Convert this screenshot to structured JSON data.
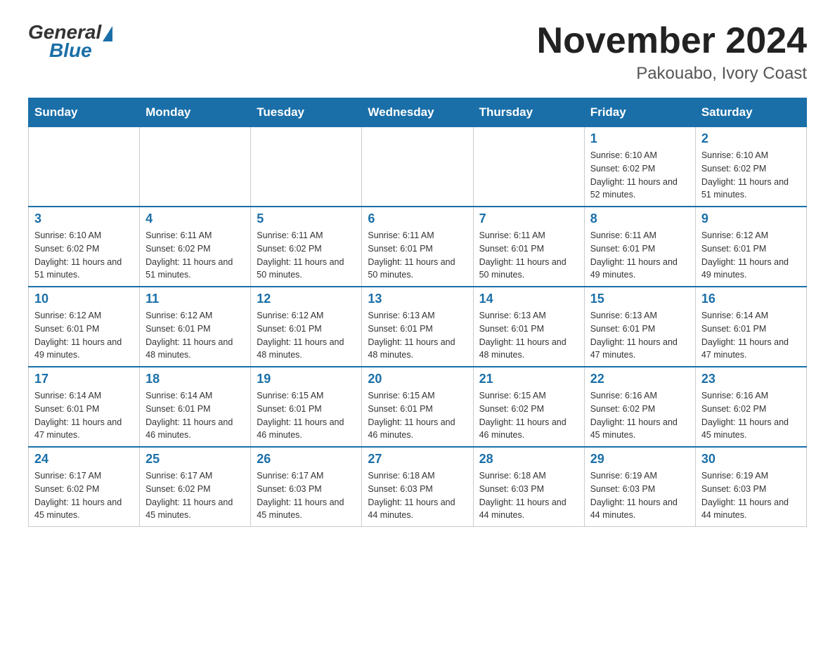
{
  "header": {
    "logo": {
      "general_text": "General",
      "blue_text": "Blue"
    },
    "title": "November 2024",
    "location": "Pakouabo, Ivory Coast"
  },
  "weekdays": [
    "Sunday",
    "Monday",
    "Tuesday",
    "Wednesday",
    "Thursday",
    "Friday",
    "Saturday"
  ],
  "weeks": [
    [
      {
        "day": "",
        "sunrise": "",
        "sunset": "",
        "daylight": ""
      },
      {
        "day": "",
        "sunrise": "",
        "sunset": "",
        "daylight": ""
      },
      {
        "day": "",
        "sunrise": "",
        "sunset": "",
        "daylight": ""
      },
      {
        "day": "",
        "sunrise": "",
        "sunset": "",
        "daylight": ""
      },
      {
        "day": "",
        "sunrise": "",
        "sunset": "",
        "daylight": ""
      },
      {
        "day": "1",
        "sunrise": "Sunrise: 6:10 AM",
        "sunset": "Sunset: 6:02 PM",
        "daylight": "Daylight: 11 hours and 52 minutes."
      },
      {
        "day": "2",
        "sunrise": "Sunrise: 6:10 AM",
        "sunset": "Sunset: 6:02 PM",
        "daylight": "Daylight: 11 hours and 51 minutes."
      }
    ],
    [
      {
        "day": "3",
        "sunrise": "Sunrise: 6:10 AM",
        "sunset": "Sunset: 6:02 PM",
        "daylight": "Daylight: 11 hours and 51 minutes."
      },
      {
        "day": "4",
        "sunrise": "Sunrise: 6:11 AM",
        "sunset": "Sunset: 6:02 PM",
        "daylight": "Daylight: 11 hours and 51 minutes."
      },
      {
        "day": "5",
        "sunrise": "Sunrise: 6:11 AM",
        "sunset": "Sunset: 6:02 PM",
        "daylight": "Daylight: 11 hours and 50 minutes."
      },
      {
        "day": "6",
        "sunrise": "Sunrise: 6:11 AM",
        "sunset": "Sunset: 6:01 PM",
        "daylight": "Daylight: 11 hours and 50 minutes."
      },
      {
        "day": "7",
        "sunrise": "Sunrise: 6:11 AM",
        "sunset": "Sunset: 6:01 PM",
        "daylight": "Daylight: 11 hours and 50 minutes."
      },
      {
        "day": "8",
        "sunrise": "Sunrise: 6:11 AM",
        "sunset": "Sunset: 6:01 PM",
        "daylight": "Daylight: 11 hours and 49 minutes."
      },
      {
        "day": "9",
        "sunrise": "Sunrise: 6:12 AM",
        "sunset": "Sunset: 6:01 PM",
        "daylight": "Daylight: 11 hours and 49 minutes."
      }
    ],
    [
      {
        "day": "10",
        "sunrise": "Sunrise: 6:12 AM",
        "sunset": "Sunset: 6:01 PM",
        "daylight": "Daylight: 11 hours and 49 minutes."
      },
      {
        "day": "11",
        "sunrise": "Sunrise: 6:12 AM",
        "sunset": "Sunset: 6:01 PM",
        "daylight": "Daylight: 11 hours and 48 minutes."
      },
      {
        "day": "12",
        "sunrise": "Sunrise: 6:12 AM",
        "sunset": "Sunset: 6:01 PM",
        "daylight": "Daylight: 11 hours and 48 minutes."
      },
      {
        "day": "13",
        "sunrise": "Sunrise: 6:13 AM",
        "sunset": "Sunset: 6:01 PM",
        "daylight": "Daylight: 11 hours and 48 minutes."
      },
      {
        "day": "14",
        "sunrise": "Sunrise: 6:13 AM",
        "sunset": "Sunset: 6:01 PM",
        "daylight": "Daylight: 11 hours and 48 minutes."
      },
      {
        "day": "15",
        "sunrise": "Sunrise: 6:13 AM",
        "sunset": "Sunset: 6:01 PM",
        "daylight": "Daylight: 11 hours and 47 minutes."
      },
      {
        "day": "16",
        "sunrise": "Sunrise: 6:14 AM",
        "sunset": "Sunset: 6:01 PM",
        "daylight": "Daylight: 11 hours and 47 minutes."
      }
    ],
    [
      {
        "day": "17",
        "sunrise": "Sunrise: 6:14 AM",
        "sunset": "Sunset: 6:01 PM",
        "daylight": "Daylight: 11 hours and 47 minutes."
      },
      {
        "day": "18",
        "sunrise": "Sunrise: 6:14 AM",
        "sunset": "Sunset: 6:01 PM",
        "daylight": "Daylight: 11 hours and 46 minutes."
      },
      {
        "day": "19",
        "sunrise": "Sunrise: 6:15 AM",
        "sunset": "Sunset: 6:01 PM",
        "daylight": "Daylight: 11 hours and 46 minutes."
      },
      {
        "day": "20",
        "sunrise": "Sunrise: 6:15 AM",
        "sunset": "Sunset: 6:01 PM",
        "daylight": "Daylight: 11 hours and 46 minutes."
      },
      {
        "day": "21",
        "sunrise": "Sunrise: 6:15 AM",
        "sunset": "Sunset: 6:02 PM",
        "daylight": "Daylight: 11 hours and 46 minutes."
      },
      {
        "day": "22",
        "sunrise": "Sunrise: 6:16 AM",
        "sunset": "Sunset: 6:02 PM",
        "daylight": "Daylight: 11 hours and 45 minutes."
      },
      {
        "day": "23",
        "sunrise": "Sunrise: 6:16 AM",
        "sunset": "Sunset: 6:02 PM",
        "daylight": "Daylight: 11 hours and 45 minutes."
      }
    ],
    [
      {
        "day": "24",
        "sunrise": "Sunrise: 6:17 AM",
        "sunset": "Sunset: 6:02 PM",
        "daylight": "Daylight: 11 hours and 45 minutes."
      },
      {
        "day": "25",
        "sunrise": "Sunrise: 6:17 AM",
        "sunset": "Sunset: 6:02 PM",
        "daylight": "Daylight: 11 hours and 45 minutes."
      },
      {
        "day": "26",
        "sunrise": "Sunrise: 6:17 AM",
        "sunset": "Sunset: 6:03 PM",
        "daylight": "Daylight: 11 hours and 45 minutes."
      },
      {
        "day": "27",
        "sunrise": "Sunrise: 6:18 AM",
        "sunset": "Sunset: 6:03 PM",
        "daylight": "Daylight: 11 hours and 44 minutes."
      },
      {
        "day": "28",
        "sunrise": "Sunrise: 6:18 AM",
        "sunset": "Sunset: 6:03 PM",
        "daylight": "Daylight: 11 hours and 44 minutes."
      },
      {
        "day": "29",
        "sunrise": "Sunrise: 6:19 AM",
        "sunset": "Sunset: 6:03 PM",
        "daylight": "Daylight: 11 hours and 44 minutes."
      },
      {
        "day": "30",
        "sunrise": "Sunrise: 6:19 AM",
        "sunset": "Sunset: 6:03 PM",
        "daylight": "Daylight: 11 hours and 44 minutes."
      }
    ]
  ]
}
